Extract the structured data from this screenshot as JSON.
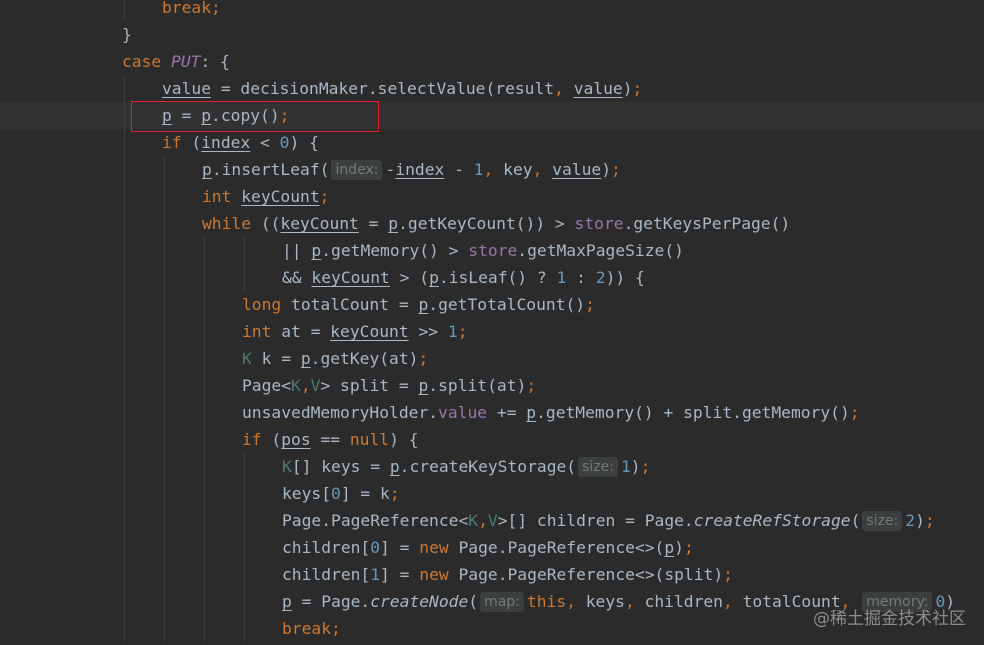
{
  "editor": {
    "lines": [
      {
        "indent": 162,
        "tokens": [
          {
            "t": "break",
            "c": "kw"
          },
          {
            "t": ";",
            "c": "kw"
          }
        ]
      },
      {
        "indent": 122,
        "tokens": [
          {
            "t": "}"
          }
        ]
      },
      {
        "indent": 122,
        "tokens": [
          {
            "t": "case ",
            "c": "kw"
          },
          {
            "t": "PUT",
            "c": "enum"
          },
          {
            "t": ": {"
          }
        ]
      },
      {
        "indent": 162,
        "tokens": [
          {
            "t": "value",
            "c": "u"
          },
          {
            "t": " = decisionMaker.selectValue(result"
          },
          {
            "t": ", ",
            "c": "kw"
          },
          {
            "t": "value",
            "c": "u"
          },
          {
            "t": ")"
          },
          {
            "t": ";",
            "c": "kw"
          }
        ]
      },
      {
        "indent": 162,
        "current": true,
        "tokens": [
          {
            "t": "p",
            "c": "u"
          },
          {
            "t": " = "
          },
          {
            "t": "p",
            "c": "u"
          },
          {
            "t": ".copy()"
          },
          {
            "t": ";",
            "c": "kw"
          }
        ]
      },
      {
        "indent": 162,
        "tokens": [
          {
            "t": "if ",
            "c": "kw"
          },
          {
            "t": "("
          },
          {
            "t": "index",
            "c": "u"
          },
          {
            "t": " < "
          },
          {
            "t": "0",
            "c": "num"
          },
          {
            "t": ") {"
          }
        ]
      },
      {
        "indent": 202,
        "tokens": [
          {
            "t": "p",
            "c": "u"
          },
          {
            "t": ".insertLeaf("
          },
          {
            "hint": "index:"
          },
          {
            "t": "-"
          },
          {
            "t": "index",
            "c": "u"
          },
          {
            "t": " - "
          },
          {
            "t": "1",
            "c": "num"
          },
          {
            "t": ", ",
            "c": "kw"
          },
          {
            "t": "key"
          },
          {
            "t": ", ",
            "c": "kw"
          },
          {
            "t": "value",
            "c": "u"
          },
          {
            "t": ")"
          },
          {
            "t": ";",
            "c": "kw"
          }
        ]
      },
      {
        "indent": 202,
        "tokens": [
          {
            "t": "int ",
            "c": "kw"
          },
          {
            "t": "keyCount",
            "c": "u"
          },
          {
            "t": ";",
            "c": "kw"
          }
        ]
      },
      {
        "indent": 202,
        "tokens": [
          {
            "t": "while ",
            "c": "kw"
          },
          {
            "t": "(("
          },
          {
            "t": "keyCount",
            "c": "u"
          },
          {
            "t": " = "
          },
          {
            "t": "p",
            "c": "u"
          },
          {
            "t": ".getKeyCount()) > "
          },
          {
            "t": "store",
            "c": "field"
          },
          {
            "t": ".getKeysPerPage()"
          }
        ]
      },
      {
        "indent": 282,
        "tokens": [
          {
            "t": "|| "
          },
          {
            "t": "p",
            "c": "u"
          },
          {
            "t": ".getMemory() > "
          },
          {
            "t": "store",
            "c": "field"
          },
          {
            "t": ".getMaxPageSize()"
          }
        ]
      },
      {
        "indent": 282,
        "tokens": [
          {
            "t": "&& "
          },
          {
            "t": "keyCount",
            "c": "u"
          },
          {
            "t": " > ("
          },
          {
            "t": "p",
            "c": "u"
          },
          {
            "t": ".isLeaf() ? "
          },
          {
            "t": "1",
            "c": "num"
          },
          {
            "t": " : "
          },
          {
            "t": "2",
            "c": "num"
          },
          {
            "t": ")) {"
          }
        ]
      },
      {
        "indent": 242,
        "tokens": [
          {
            "t": "long ",
            "c": "kw"
          },
          {
            "t": "totalCount = "
          },
          {
            "t": "p",
            "c": "u"
          },
          {
            "t": ".getTotalCount()"
          },
          {
            "t": ";",
            "c": "kw"
          }
        ]
      },
      {
        "indent": 242,
        "tokens": [
          {
            "t": "int ",
            "c": "kw"
          },
          {
            "t": "at = "
          },
          {
            "t": "keyCount",
            "c": "u"
          },
          {
            "t": " >> "
          },
          {
            "t": "1",
            "c": "num"
          },
          {
            "t": ";",
            "c": "kw"
          }
        ]
      },
      {
        "indent": 242,
        "tokens": [
          {
            "t": "K",
            "c": "tp"
          },
          {
            "t": " k = "
          },
          {
            "t": "p",
            "c": "u"
          },
          {
            "t": ".getKey(at)"
          },
          {
            "t": ";",
            "c": "kw"
          }
        ]
      },
      {
        "indent": 242,
        "tokens": [
          {
            "t": "Page<"
          },
          {
            "t": "K",
            "c": "tp"
          },
          {
            "t": ",",
            "c": "kw"
          },
          {
            "t": "V",
            "c": "tp"
          },
          {
            "t": "> split = "
          },
          {
            "t": "p",
            "c": "u"
          },
          {
            "t": ".split(at)"
          },
          {
            "t": ";",
            "c": "kw"
          }
        ]
      },
      {
        "indent": 242,
        "tokens": [
          {
            "t": "unsavedMemoryHolder."
          },
          {
            "t": "value",
            "c": "field"
          },
          {
            "t": " += "
          },
          {
            "t": "p",
            "c": "u"
          },
          {
            "t": ".getMemory() + split.getMemory()"
          },
          {
            "t": ";",
            "c": "kw"
          }
        ]
      },
      {
        "indent": 242,
        "tokens": [
          {
            "t": "if ",
            "c": "kw"
          },
          {
            "t": "("
          },
          {
            "t": "pos",
            "c": "u"
          },
          {
            "t": " == "
          },
          {
            "t": "null",
            "c": "kw"
          },
          {
            "t": ") {"
          }
        ]
      },
      {
        "indent": 282,
        "tokens": [
          {
            "t": "K",
            "c": "tp"
          },
          {
            "t": "[] keys = "
          },
          {
            "t": "p",
            "c": "u"
          },
          {
            "t": ".createKeyStorage("
          },
          {
            "hint": "size:"
          },
          {
            "t": "1",
            "c": "num"
          },
          {
            "t": ")"
          },
          {
            "t": ";",
            "c": "kw"
          }
        ]
      },
      {
        "indent": 282,
        "tokens": [
          {
            "t": "keys["
          },
          {
            "t": "0",
            "c": "num"
          },
          {
            "t": "] = k"
          },
          {
            "t": ";",
            "c": "kw"
          }
        ]
      },
      {
        "indent": 282,
        "tokens": [
          {
            "t": "Page.PageReference<"
          },
          {
            "t": "K",
            "c": "tp"
          },
          {
            "t": ",",
            "c": "kw"
          },
          {
            "t": "V",
            "c": "tp"
          },
          {
            "t": ">[] children = Page."
          },
          {
            "t": "createRefStorage",
            "c": "static"
          },
          {
            "t": "("
          },
          {
            "hint": "size:"
          },
          {
            "t": "2",
            "c": "num"
          },
          {
            "t": ")"
          },
          {
            "t": ";",
            "c": "kw"
          }
        ]
      },
      {
        "indent": 282,
        "tokens": [
          {
            "t": "children["
          },
          {
            "t": "0",
            "c": "num"
          },
          {
            "t": "] = "
          },
          {
            "t": "new ",
            "c": "kw"
          },
          {
            "t": "Page.PageReference<>("
          },
          {
            "t": "p",
            "c": "u"
          },
          {
            "t": ")"
          },
          {
            "t": ";",
            "c": "kw"
          }
        ]
      },
      {
        "indent": 282,
        "tokens": [
          {
            "t": "children["
          },
          {
            "t": "1",
            "c": "num"
          },
          {
            "t": "] = "
          },
          {
            "t": "new ",
            "c": "kw"
          },
          {
            "t": "Page.PageReference<>(split)"
          },
          {
            "t": ";",
            "c": "kw"
          }
        ]
      },
      {
        "indent": 282,
        "tokens": [
          {
            "t": "p",
            "c": "u"
          },
          {
            "t": " = Page."
          },
          {
            "t": "createNode",
            "c": "static"
          },
          {
            "t": "("
          },
          {
            "hint": "map:"
          },
          {
            "t": "this",
            "c": "kw"
          },
          {
            "t": ", ",
            "c": "kw"
          },
          {
            "t": "keys"
          },
          {
            "t": ", ",
            "c": "kw"
          },
          {
            "t": "children"
          },
          {
            "t": ", ",
            "c": "kw"
          },
          {
            "t": "totalCount"
          },
          {
            "t": ", ",
            "c": "kw"
          },
          {
            "hint": "memory:"
          },
          {
            "t": "0",
            "c": "num"
          },
          {
            "t": ")"
          }
        ]
      },
      {
        "indent": 282,
        "tokens": [
          {
            "t": "break",
            "c": "kw"
          },
          {
            "t": ";",
            "c": "kw"
          }
        ]
      }
    ]
  },
  "watermark": "@稀土掘金技术社区",
  "colors": {
    "background": "#2b2b2b",
    "current_line": "#323232",
    "text": "#a9b7c6",
    "keyword": "#cc7832",
    "field": "#9876aa",
    "number": "#6897bb",
    "type_param": "#507874",
    "hint_bg": "#3b3f40",
    "hint_text": "#787878",
    "highlight_box": "#e0202a"
  }
}
